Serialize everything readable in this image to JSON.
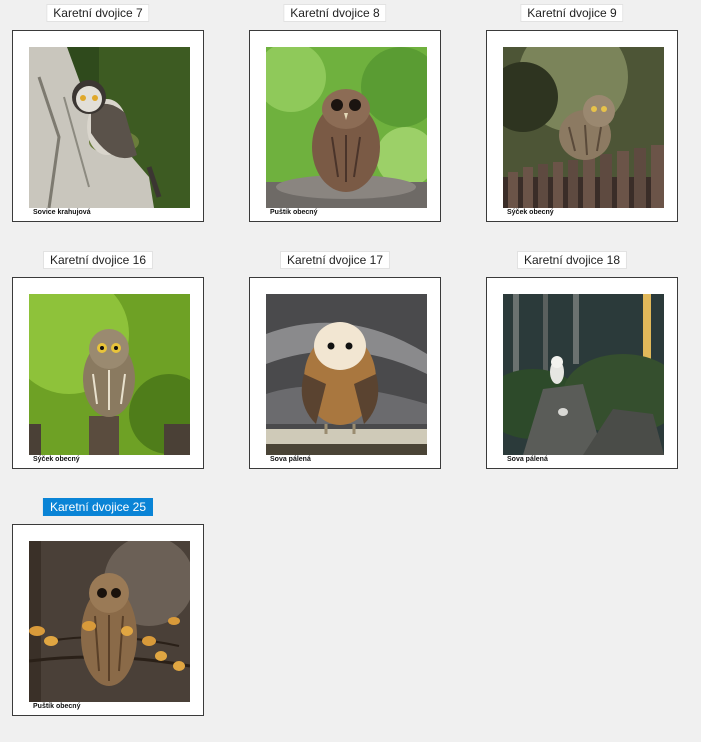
{
  "tiles": [
    {
      "label": "Karetní dvojice 7",
      "caption": "Sovice krahujová",
      "selected": false
    },
    {
      "label": "Karetní dvojice 8",
      "caption": "Puštík obecný",
      "selected": false
    },
    {
      "label": "Karetní dvojice 9",
      "caption": "Sýček obecný",
      "selected": false
    },
    {
      "label": "Karetní dvojice 16",
      "caption": "Sýček obecný",
      "selected": false
    },
    {
      "label": "Karetní dvojice 17",
      "caption": "Sova pálená",
      "selected": false
    },
    {
      "label": "Karetní dvojice 18",
      "caption": "Sova pálená",
      "selected": false
    },
    {
      "label": "Karetní dvojice 25",
      "caption": "Puštík obecný",
      "selected": true
    }
  ],
  "colors": {
    "selection_accent": "#0a84d6",
    "canvas_background": "#f0f0f0"
  }
}
